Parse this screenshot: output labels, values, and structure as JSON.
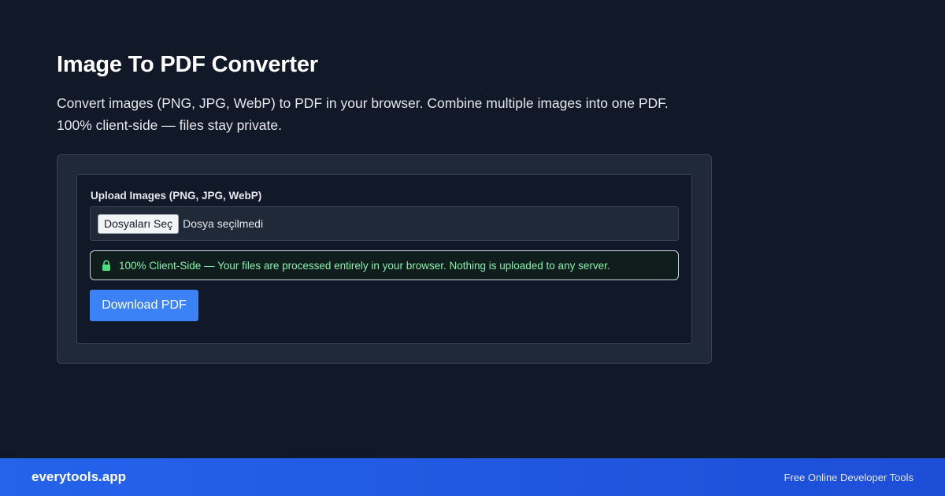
{
  "header": {
    "title": "Image To PDF Converter",
    "description_line1": "Convert images (PNG, JPG, WebP) to PDF in your browser. Combine multiple images into one PDF.",
    "description_line2": "100% client-side — files stay private."
  },
  "upload": {
    "label": "Upload Images (PNG, JPG, WebP)",
    "choose_button_label": "Dosyaları Seç",
    "file_status": "Dosya seçilmedi"
  },
  "privacy_notice": {
    "icon": "lock-icon",
    "text": "100% Client-Side — Your files are processed entirely in your browser. Nothing is uploaded to any server."
  },
  "actions": {
    "download_label": "Download PDF"
  },
  "footer": {
    "brand": "everytools.app",
    "tagline": "Free Online Developer Tools"
  },
  "colors": {
    "background": "#111827",
    "card": "#1f2937",
    "accent": "#3b82f6",
    "success_text": "#86efac",
    "footer": "#2563eb"
  }
}
